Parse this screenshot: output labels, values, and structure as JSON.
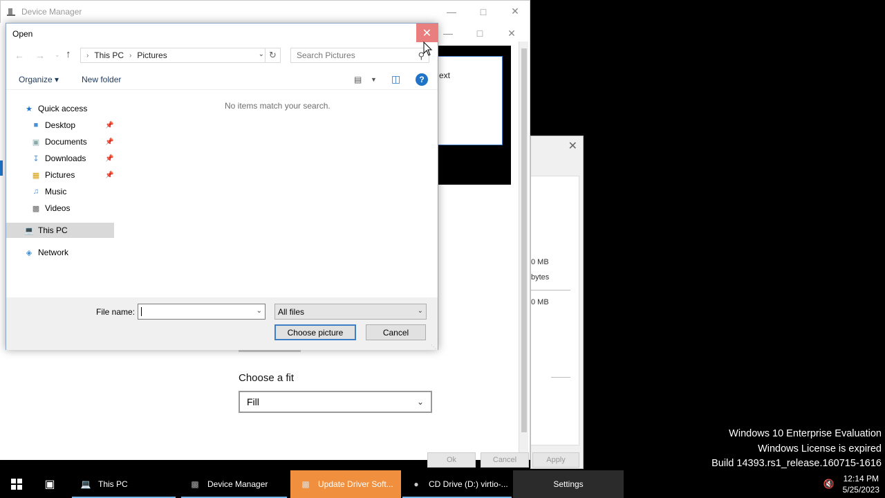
{
  "device_manager": {
    "title": "Device Manager"
  },
  "settings_bg": {
    "preview_text": "ext",
    "fit_label": "Choose a fit",
    "fit_value": "Fill"
  },
  "properties_bg": {
    "rows": [
      "0 MB",
      "bytes",
      "0 MB"
    ],
    "ok": "Ok",
    "cancel": "Cancel",
    "apply": "Apply"
  },
  "open_dialog": {
    "title": "Open",
    "breadcrumb": [
      "This PC",
      "Pictures"
    ],
    "search_placeholder": "Search Pictures",
    "organize": "Organize",
    "new_folder": "New folder",
    "help": "?",
    "empty_message": "No items match your search.",
    "nav": {
      "quick_access": "Quick access",
      "items": [
        "Desktop",
        "Documents",
        "Downloads",
        "Pictures",
        "Music",
        "Videos"
      ],
      "this_pc": "This PC",
      "network": "Network"
    },
    "file_name_label": "File name:",
    "file_name_value": "",
    "file_type": "All files",
    "choose_button": "Choose picture",
    "cancel_button": "Cancel"
  },
  "watermark": {
    "line1": "Windows 10 Enterprise Evaluation",
    "line2": "Windows License is expired",
    "line3": "Build 14393.rs1_release.160715-1616"
  },
  "taskbar": {
    "items": [
      "This PC",
      "Device Manager",
      "Update Driver Soft...",
      "CD Drive (D:) virtio-...",
      "Settings"
    ],
    "time": "12:14 PM",
    "date": "5/25/2023"
  },
  "colors": {
    "accent": "#1f74c7",
    "close_hover": "#e87e7e",
    "active_task": "#f0903f"
  }
}
